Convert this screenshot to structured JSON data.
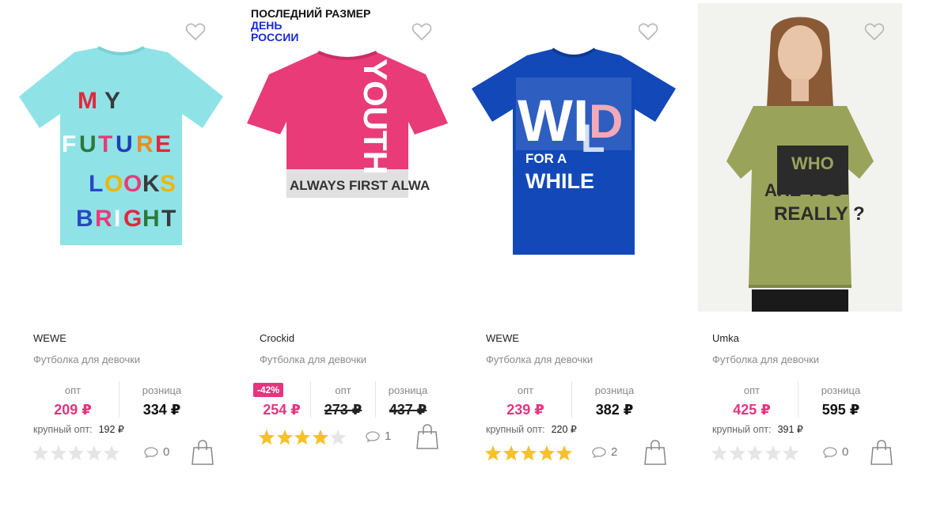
{
  "labels": {
    "opt": "опт",
    "retail": "розница",
    "bulk": "крупный опт:"
  },
  "colors": {
    "price_accent": "#e6347e",
    "star_on": "#f6c12a",
    "star_off": "#e5e5e5",
    "holiday_badge": "#1a2bd6"
  },
  "products": [
    {
      "brand": "WEWE",
      "name": "Футболка для девочки",
      "opt_price": "209 ₽",
      "retail_price": "334 ₽",
      "bulk_price": "192 ₽",
      "rating": 0,
      "comments": "0",
      "image": {
        "kind": "tshirt",
        "shirt_color": "#8fe3e6",
        "print_text": "MY FUTURE LOOKS BRIGHT"
      }
    },
    {
      "brand": "Crockid",
      "name": "Футболка для девочки",
      "badge_last": "ПОСЛЕДНИЙ РАЗМЕР",
      "badge_holiday": "ДЕНЬ РОССИИ",
      "discount": "-42%",
      "opt_price": "254 ₽",
      "opt_price_old": "273 ₽",
      "retail_price_old": "437 ₽",
      "rating": 4,
      "comments": "1",
      "image": {
        "kind": "tshirt",
        "shirt_color": "#e83b78",
        "print_text": "YOUTH",
        "band_text": "ALWAYS FIRST ALWA"
      }
    },
    {
      "brand": "WEWE",
      "name": "Футболка для девочки",
      "opt_price": "239 ₽",
      "retail_price": "382 ₽",
      "bulk_price": "220 ₽",
      "rating": 5,
      "comments": "2",
      "image": {
        "kind": "tshirt",
        "shirt_color": "#1248b8",
        "print_text": "WILD",
        "print_sub": "FOR A WHILE"
      }
    },
    {
      "brand": "Umka",
      "name": "Футболка для девочки",
      "opt_price": "425 ₽",
      "retail_price": "595 ₽",
      "bulk_price": "391 ₽",
      "rating": 0,
      "comments": "0",
      "image": {
        "kind": "model-photo",
        "shirt_color": "#9aa35a",
        "print_text": "WHO ARE YOU REALLY ?"
      }
    }
  ]
}
